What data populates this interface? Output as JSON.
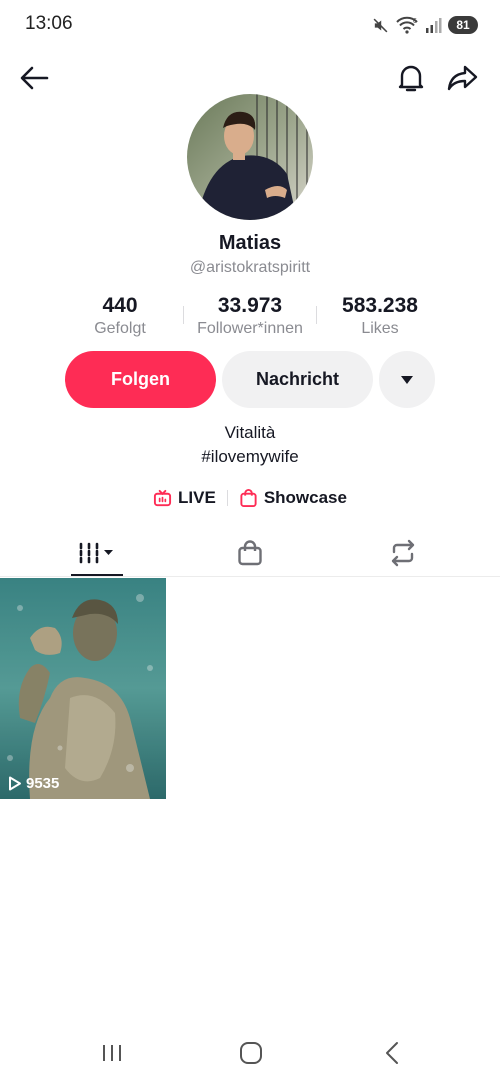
{
  "status_bar": {
    "time": "13:06",
    "battery": "81",
    "icons": [
      "mute-icon",
      "wifi-icon",
      "signal-icon",
      "battery-icon"
    ]
  },
  "nav": {
    "back_icon": "back-arrow-icon",
    "bell_icon": "bell-icon",
    "share_icon": "share-icon"
  },
  "profile": {
    "name": "Matias",
    "handle": "@aristokratspiritt",
    "stats": [
      {
        "value": "440",
        "label": "Gefolgt"
      },
      {
        "value": "33.973",
        "label": "Follower*innen"
      },
      {
        "value": "583.238",
        "label": "Likes"
      }
    ],
    "follow_label": "Folgen",
    "message_label": "Nachricht",
    "bio_line1": "Vitalità",
    "bio_line2": "#ilovemywife",
    "live_label": "LIVE",
    "showcase_label": "Showcase"
  },
  "tabs": [
    "videos-grid-icon",
    "shop-bag-icon",
    "repost-icon"
  ],
  "videos": [
    {
      "views": "9535"
    }
  ],
  "colors": {
    "accent": "#fe2c55",
    "button_gray": "#f1f1f2",
    "text_secondary": "#8a8b91"
  }
}
